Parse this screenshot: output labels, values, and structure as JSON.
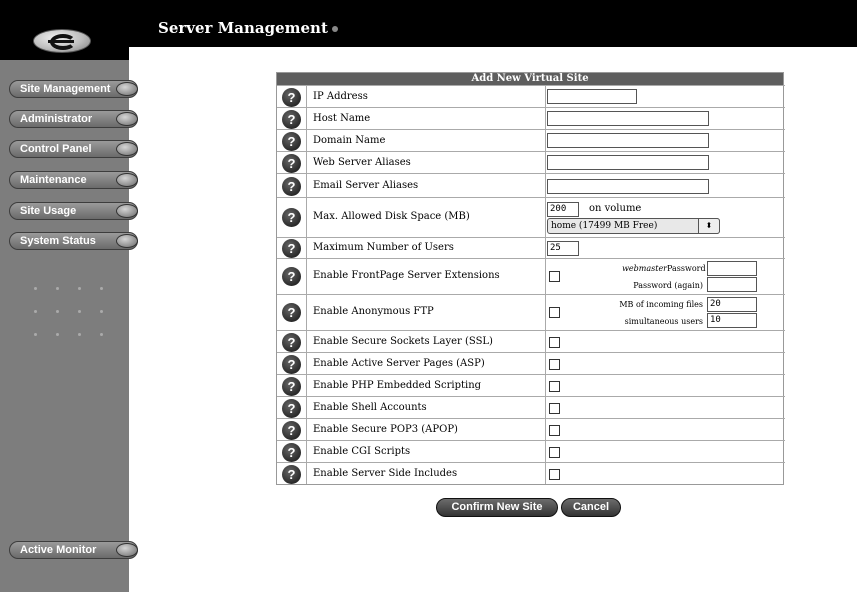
{
  "header": {
    "title": "Server Management"
  },
  "sidebar": {
    "items": [
      {
        "label": "Site Management"
      },
      {
        "label": "Administrator"
      },
      {
        "label": "Control Panel"
      },
      {
        "label": "Maintenance"
      },
      {
        "label": "Site Usage"
      },
      {
        "label": "System Status"
      }
    ],
    "bottom_item": {
      "label": "Active Monitor"
    }
  },
  "form": {
    "title": "Add New Virtual Site",
    "rows": [
      {
        "label": "IP Address",
        "value": ""
      },
      {
        "label": "Host Name",
        "value": ""
      },
      {
        "label": "Domain Name",
        "value": ""
      },
      {
        "label": "Web Server Aliases",
        "value": ""
      },
      {
        "label": "Email Server Aliases",
        "value": ""
      },
      {
        "label": "Max. Allowed Disk Space (MB)",
        "value": "200",
        "suffix": "on volume",
        "select_value": "home (17499 MB Free)"
      },
      {
        "label": "Maximum Number of Users",
        "value": "25"
      },
      {
        "label": "Enable FrontPage Server Extensions",
        "user_label": "webmaster",
        "password_label": "Password",
        "password_again_label": "Password (again)"
      },
      {
        "label": "Enable Anonymous FTP",
        "mb_label": "MB of incoming files",
        "mb_value": "20",
        "users_label": "simultaneous users",
        "users_value": "10"
      },
      {
        "label": "Enable Secure Sockets Layer (SSL)"
      },
      {
        "label": "Enable Active Server Pages (ASP)"
      },
      {
        "label": "Enable PHP Embedded Scripting"
      },
      {
        "label": "Enable Shell Accounts"
      },
      {
        "label": "Enable Secure POP3 (APOP)"
      },
      {
        "label": "Enable CGI Scripts"
      },
      {
        "label": "Enable Server Side Includes"
      }
    ]
  },
  "buttons": {
    "confirm": "Confirm New Site",
    "cancel": "Cancel"
  },
  "icons": {
    "help": "?",
    "select_arrows": "⬍"
  }
}
